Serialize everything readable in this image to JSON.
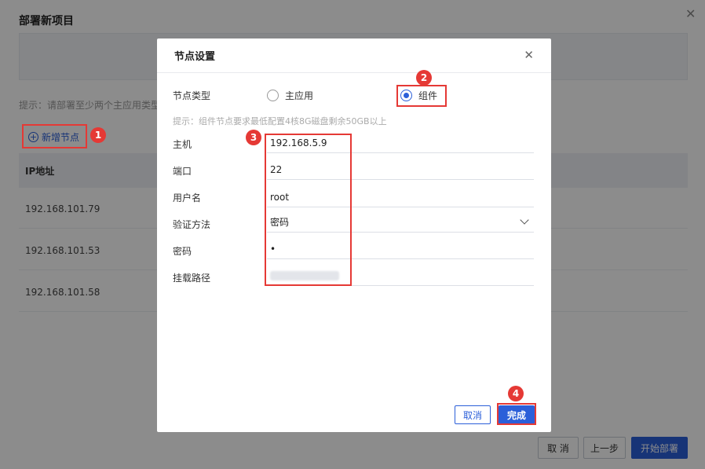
{
  "background": {
    "title": "部署新项目",
    "tip": "提示：请部署至少两个主应用类型",
    "add_node": "新增节点",
    "table": {
      "header": "IP地址",
      "rows": [
        "192.168.101.79",
        "192.168.101.53",
        "192.168.101.58"
      ]
    },
    "buttons": {
      "cancel": "取 消",
      "prev": "上一步",
      "deploy": "开始部署"
    }
  },
  "dialog": {
    "title": "节点设置",
    "node_type_label": "节点类型",
    "node_types": [
      "主应用",
      "组件"
    ],
    "selected_type": "组件",
    "hint": "提示：组件节点要求最低配置4核8G磁盘剩余50GB以上",
    "fields": {
      "host_label": "主机",
      "host_value": "192.168.5.9",
      "port_label": "端口",
      "port_value": "22",
      "user_label": "用户名",
      "user_value": "root",
      "auth_label": "验证方法",
      "auth_value": "密码",
      "password_label": "密码",
      "password_value": "•",
      "mount_label": "挂载路径"
    },
    "buttons": {
      "cancel": "取消",
      "ok": "完成"
    }
  },
  "annotations": [
    "1",
    "2",
    "3",
    "4"
  ],
  "colors": {
    "accent": "#2b5fd9",
    "annotation": "#e53935"
  }
}
